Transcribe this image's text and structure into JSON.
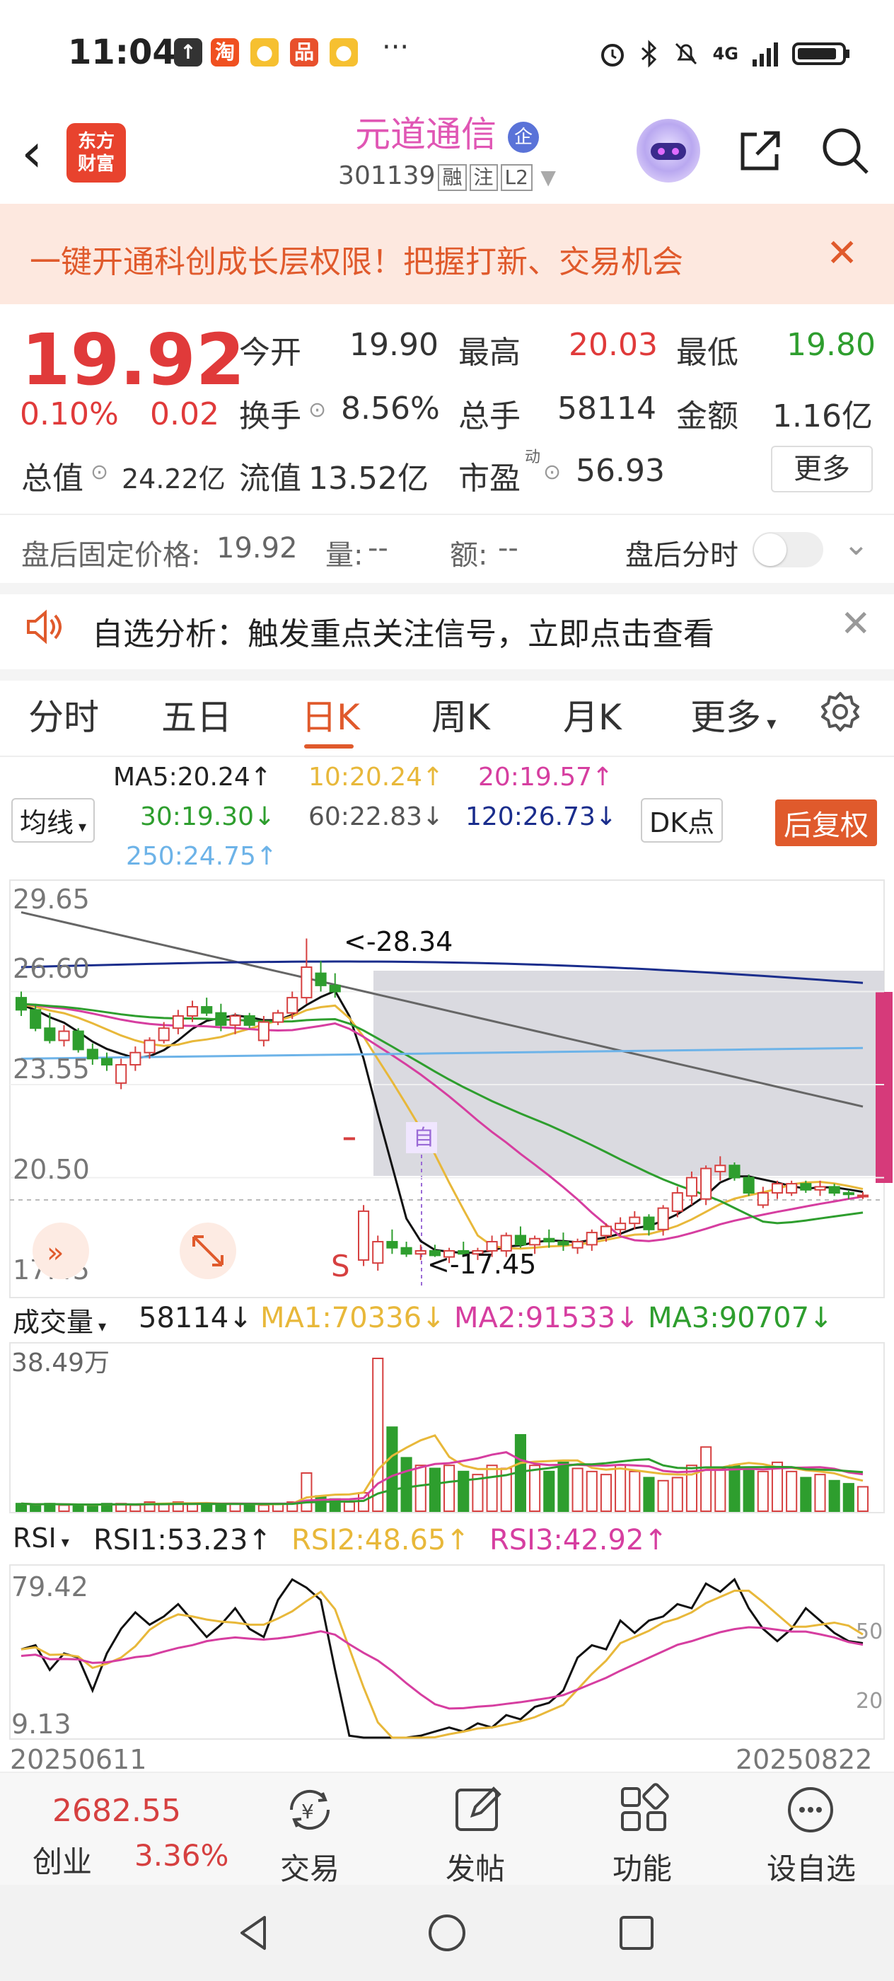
{
  "status_bar": {
    "time": "11:04",
    "more": "···",
    "network": "4G"
  },
  "header": {
    "app_logo": "东方财富",
    "stock_name": "元道通信",
    "stock_badge": "企",
    "stock_code": "301139",
    "tags": [
      "融",
      "注",
      "L2"
    ]
  },
  "banner": {
    "text": "一键开通科创成长层权限！把握打新、交易机会"
  },
  "quote": {
    "price": "19.92",
    "change_pct": "0.10%",
    "change": "0.02",
    "open_label": "今开",
    "open": "19.90",
    "high_label": "最高",
    "high": "20.03",
    "low_label": "最低",
    "low": "19.80",
    "turnover_label": "换手",
    "turnover": "8.56%",
    "volume_label": "总手",
    "volume": "58114",
    "amount_label": "金额",
    "amount": "1.16亿",
    "mktcap_label": "总值",
    "mktcap": "24.22亿",
    "float_label": "流值",
    "float": "13.52亿",
    "pe_label": "市盈",
    "pe_sup": "动",
    "pe": "56.93",
    "more_label": "更多"
  },
  "after_hours": {
    "price_label": "盘后固定价格:",
    "price": "19.92",
    "qty_label": "量:",
    "qty": "--",
    "amt_label": "额:",
    "amt": "--",
    "toggle_label": "盘后分时"
  },
  "analysis": {
    "text": "自选分析：触发重点关注信号，立即点击查看"
  },
  "tabs": [
    "分时",
    "五日",
    "日K",
    "周K",
    "月K",
    "更多"
  ],
  "active_tab": "日K",
  "ma": {
    "ma5": "MA5:20.24↑",
    "ma10": "10:20.24↑",
    "ma20": "20:19.57↑",
    "ma30": "30:19.30↓",
    "ma60": "60:22.83↓",
    "ma120": "120:26.73↓",
    "ma250": "250:24.75↑",
    "selector": "均线",
    "dk": "DK点",
    "adjust": "后复权"
  },
  "colors": {
    "ma5": "#111111",
    "ma10": "#e8b83a",
    "ma20": "#d63ea0",
    "ma30": "#2e9e2e",
    "ma60": "#666666",
    "ma120": "#1a2d8c",
    "ma250": "#6db3e8",
    "up": "#d64040",
    "down": "#2e9e2e",
    "accent": "#e05a2c"
  },
  "kline": {
    "y_ticks": [
      "29.65",
      "26.60",
      "23.55",
      "20.50",
      "17.45"
    ],
    "high_marker": "<-28.34",
    "low_marker": "<-17.45",
    "sell_marker": "S",
    "self_marker": "自",
    "candles": [
      {
        "o": 26.4,
        "h": 26.6,
        "l": 25.8,
        "c": 26.0
      },
      {
        "o": 26.0,
        "h": 26.2,
        "l": 25.3,
        "c": 25.4
      },
      {
        "o": 25.4,
        "h": 25.9,
        "l": 24.9,
        "c": 25.0
      },
      {
        "o": 25.0,
        "h": 25.5,
        "l": 24.8,
        "c": 25.3
      },
      {
        "o": 25.3,
        "h": 25.4,
        "l": 24.6,
        "c": 24.7
      },
      {
        "o": 24.7,
        "h": 24.9,
        "l": 24.2,
        "c": 24.4
      },
      {
        "o": 24.4,
        "h": 24.6,
        "l": 24.0,
        "c": 24.2
      },
      {
        "o": 23.6,
        "h": 24.4,
        "l": 23.4,
        "c": 24.2
      },
      {
        "o": 24.2,
        "h": 24.8,
        "l": 24.0,
        "c": 24.6
      },
      {
        "o": 24.6,
        "h": 25.1,
        "l": 24.4,
        "c": 25.0
      },
      {
        "o": 25.0,
        "h": 25.6,
        "l": 24.9,
        "c": 25.4
      },
      {
        "o": 25.4,
        "h": 26.0,
        "l": 25.2,
        "c": 25.8
      },
      {
        "o": 25.8,
        "h": 26.3,
        "l": 25.6,
        "c": 26.1
      },
      {
        "o": 26.1,
        "h": 26.4,
        "l": 25.8,
        "c": 25.9
      },
      {
        "o": 25.9,
        "h": 26.2,
        "l": 25.3,
        "c": 25.5
      },
      {
        "o": 25.5,
        "h": 25.9,
        "l": 25.2,
        "c": 25.8
      },
      {
        "o": 25.8,
        "h": 25.9,
        "l": 25.4,
        "c": 25.5
      },
      {
        "o": 25.0,
        "h": 25.8,
        "l": 24.8,
        "c": 25.6
      },
      {
        "o": 25.6,
        "h": 26.0,
        "l": 25.5,
        "c": 25.9
      },
      {
        "o": 25.9,
        "h": 26.6,
        "l": 25.7,
        "c": 26.4
      },
      {
        "o": 26.4,
        "h": 28.34,
        "l": 26.2,
        "c": 27.4
      },
      {
        "o": 27.2,
        "h": 27.6,
        "l": 26.6,
        "c": 26.8
      },
      {
        "o": 26.8,
        "h": 27.2,
        "l": 26.4,
        "c": 26.6
      },
      {
        "o": 21.8,
        "h": 21.8,
        "l": 21.8,
        "c": 21.8
      },
      {
        "o": 17.8,
        "h": 19.6,
        "l": 17.6,
        "c": 19.4
      },
      {
        "o": 17.7,
        "h": 18.6,
        "l": 17.45,
        "c": 18.4
      },
      {
        "o": 18.4,
        "h": 18.8,
        "l": 18.0,
        "c": 18.2
      },
      {
        "o": 18.2,
        "h": 18.4,
        "l": 17.9,
        "c": 18.0
      },
      {
        "o": 18.0,
        "h": 18.3,
        "l": 17.8,
        "c": 18.1
      },
      {
        "o": 18.1,
        "h": 18.3,
        "l": 17.9,
        "c": 17.95
      },
      {
        "o": 17.9,
        "h": 18.2,
        "l": 17.7,
        "c": 18.1
      },
      {
        "o": 18.1,
        "h": 18.4,
        "l": 17.9,
        "c": 18.0
      },
      {
        "o": 18.0,
        "h": 18.2,
        "l": 17.8,
        "c": 18.1
      },
      {
        "o": 18.1,
        "h": 18.6,
        "l": 17.9,
        "c": 18.4
      },
      {
        "o": 18.1,
        "h": 18.7,
        "l": 17.9,
        "c": 18.6
      },
      {
        "o": 18.6,
        "h": 18.9,
        "l": 18.2,
        "c": 18.3
      },
      {
        "o": 18.3,
        "h": 18.6,
        "l": 18.0,
        "c": 18.5
      },
      {
        "o": 18.5,
        "h": 18.8,
        "l": 18.2,
        "c": 18.4
      },
      {
        "o": 18.4,
        "h": 18.7,
        "l": 18.1,
        "c": 18.3
      },
      {
        "o": 18.2,
        "h": 18.5,
        "l": 18.0,
        "c": 18.4
      },
      {
        "o": 18.3,
        "h": 18.8,
        "l": 18.1,
        "c": 18.7
      },
      {
        "o": 18.6,
        "h": 19.0,
        "l": 18.4,
        "c": 18.9
      },
      {
        "o": 18.8,
        "h": 19.2,
        "l": 18.6,
        "c": 19.0
      },
      {
        "o": 19.0,
        "h": 19.4,
        "l": 18.8,
        "c": 19.2
      },
      {
        "o": 19.2,
        "h": 19.3,
        "l": 18.6,
        "c": 18.8
      },
      {
        "o": 18.8,
        "h": 19.6,
        "l": 18.6,
        "c": 19.5
      },
      {
        "o": 19.4,
        "h": 20.2,
        "l": 19.2,
        "c": 20.0
      },
      {
        "o": 19.9,
        "h": 20.7,
        "l": 19.6,
        "c": 20.5
      },
      {
        "o": 19.8,
        "h": 20.9,
        "l": 19.6,
        "c": 20.8
      },
      {
        "o": 20.7,
        "h": 21.2,
        "l": 20.4,
        "c": 20.9
      },
      {
        "o": 20.9,
        "h": 21.0,
        "l": 20.4,
        "c": 20.5
      },
      {
        "o": 20.5,
        "h": 20.6,
        "l": 19.9,
        "c": 20.0
      },
      {
        "o": 19.6,
        "h": 20.2,
        "l": 19.5,
        "c": 20.0
      },
      {
        "o": 20.0,
        "h": 20.4,
        "l": 19.8,
        "c": 20.3
      },
      {
        "o": 20.0,
        "h": 20.4,
        "l": 19.9,
        "c": 20.3
      },
      {
        "o": 20.3,
        "h": 20.4,
        "l": 20.0,
        "c": 20.1
      },
      {
        "o": 20.1,
        "h": 20.4,
        "l": 19.9,
        "c": 20.2
      },
      {
        "o": 20.2,
        "h": 20.3,
        "l": 19.9,
        "c": 20.0
      },
      {
        "o": 20.0,
        "h": 20.1,
        "l": 19.8,
        "c": 19.95
      },
      {
        "o": 19.9,
        "h": 20.03,
        "l": 19.8,
        "c": 19.92
      }
    ]
  },
  "volume": {
    "selector": "成交量",
    "value": "58114↓",
    "ma1": "MA1:70336↓",
    "ma2": "MA2:91533↓",
    "ma3": "MA3:90707↓",
    "max_label": "38.49万"
  },
  "rsi": {
    "selector": "RSI",
    "rsi1": "RSI1:53.23↑",
    "rsi2": "RSI2:48.65↑",
    "rsi3": "RSI3:42.92↑",
    "top": "79.42",
    "bottom": "9.13",
    "line50": "50",
    "line20": "20",
    "date_start": "20250611",
    "date_end": "20250822"
  },
  "bottom_bar": {
    "index_value": "2682.55",
    "index_name": "创业",
    "index_pct": "3.36%",
    "trade": "交易",
    "post": "发帖",
    "functions": "功能",
    "watch": "设自选"
  }
}
